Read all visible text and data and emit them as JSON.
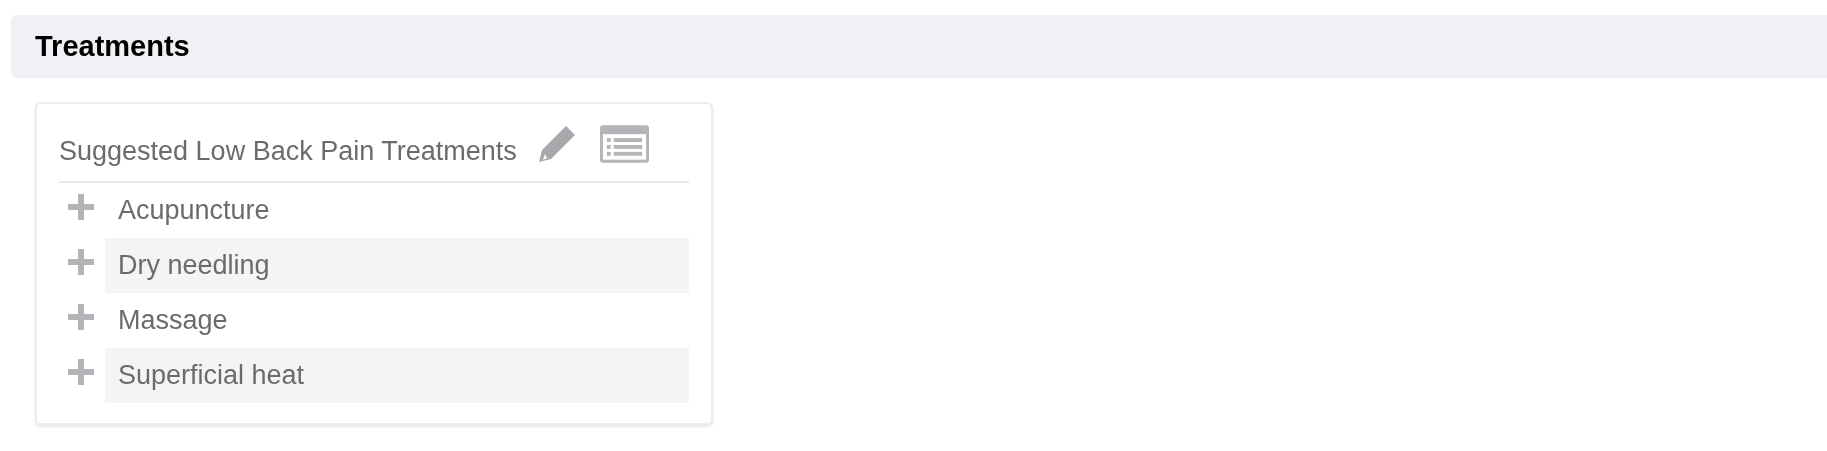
{
  "section": {
    "title": "Treatments"
  },
  "card": {
    "title": "Suggested Low Back Pain Treatments",
    "items": [
      {
        "label": "Acupuncture"
      },
      {
        "label": "Dry needling"
      },
      {
        "label": "Massage"
      },
      {
        "label": "Superficial heat"
      }
    ]
  }
}
